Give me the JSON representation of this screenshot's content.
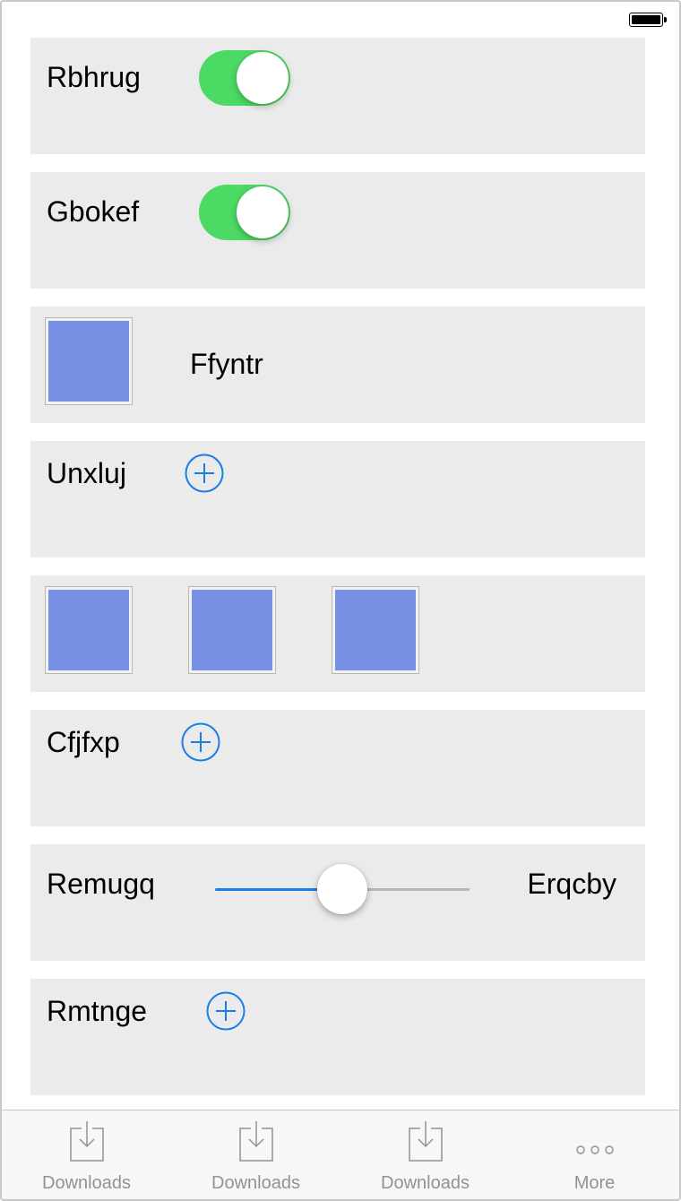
{
  "colors": {
    "accent": "#1a7ee8",
    "toggle_on": "#4cd964",
    "card_bg": "#ebebeb",
    "image_fill": "#7891e4",
    "tab_label": "#929292"
  },
  "rows": {
    "r1": {
      "label": "Rbhrug",
      "toggle_on": true
    },
    "r2": {
      "label": "Gbokef",
      "toggle_on": true
    },
    "r3": {
      "label": "Ffyntr",
      "icon": "image-placeholder"
    },
    "r4": {
      "label": "Unxluj",
      "icon": "plus-circle-icon"
    },
    "r5": {
      "images": [
        "image-placeholder",
        "image-placeholder",
        "image-placeholder"
      ]
    },
    "r6": {
      "label": "Cfjfxp",
      "icon": "plus-circle-icon"
    },
    "r7": {
      "label": "Remugq",
      "value_label": "Erqcby",
      "slider_value": 0.5
    },
    "r8": {
      "label": "Rmtnge",
      "icon": "plus-circle-icon"
    }
  },
  "tabbar": {
    "items": [
      {
        "label": "Downloads",
        "icon": "download-icon"
      },
      {
        "label": "Downloads",
        "icon": "download-icon"
      },
      {
        "label": "Downloads",
        "icon": "download-icon"
      },
      {
        "label": "More",
        "icon": "more-icon"
      }
    ]
  }
}
